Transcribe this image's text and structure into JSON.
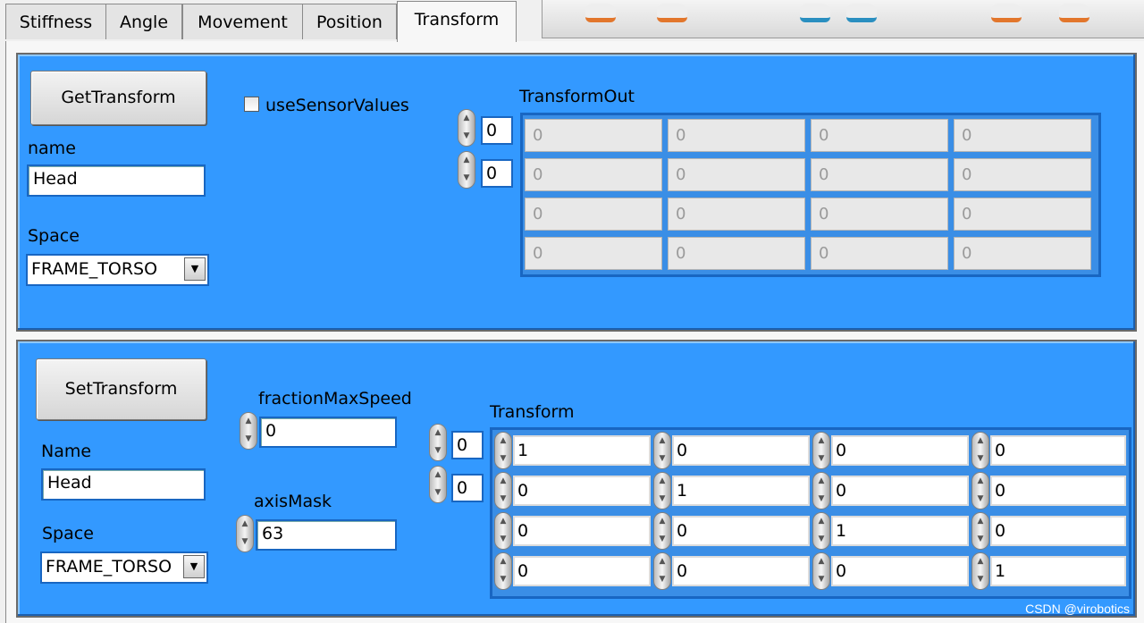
{
  "tabs": [
    "Stiffness",
    "Angle",
    "Movement",
    "Position",
    "Transform"
  ],
  "get_panel": {
    "button": "GetTransform",
    "checkbox_label": "useSensorValues",
    "name_label": "name",
    "name_value": "Head",
    "space_label": "Space",
    "space_value": "FRAME_TORSO",
    "matrix_label": "TransformOut",
    "row_index": "0",
    "col_index": "0",
    "matrix": [
      [
        "0",
        "0",
        "0",
        "0"
      ],
      [
        "0",
        "0",
        "0",
        "0"
      ],
      [
        "0",
        "0",
        "0",
        "0"
      ],
      [
        "0",
        "0",
        "0",
        "0"
      ]
    ]
  },
  "set_panel": {
    "button": "SetTransform",
    "name_label": "Name",
    "name_value": "Head",
    "space_label": "Space",
    "space_value": "FRAME_TORSO",
    "speed_label": "fractionMaxSpeed",
    "speed_value": "0",
    "axis_label": "axisMask",
    "axis_value": "63",
    "matrix_label": "Transform",
    "row_index": "0",
    "col_index": "0",
    "matrix": [
      [
        "1",
        "0",
        "0",
        "0"
      ],
      [
        "0",
        "1",
        "0",
        "0"
      ],
      [
        "0",
        "0",
        "1",
        "0"
      ],
      [
        "0",
        "0",
        "0",
        "1"
      ]
    ]
  },
  "watermark": "CSDN @virobotics",
  "colors": {
    "panel": "#3399ff",
    "panel_border": "#1866c2"
  }
}
